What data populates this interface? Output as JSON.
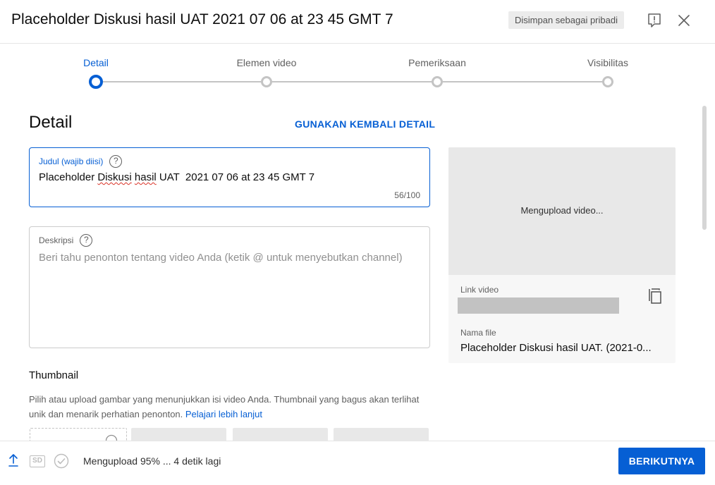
{
  "dialog": {
    "title": "Placeholder Diskusi hasil UAT 2021 07 06 at 23 45 GMT 7",
    "saved_status": "Disimpan sebagai pribadi",
    "report_icon": "report-icon",
    "close_icon": "close-icon"
  },
  "stepper": {
    "steps": [
      {
        "label": "Detail",
        "active": true
      },
      {
        "label": "Elemen video",
        "active": false
      },
      {
        "label": "Pemeriksaan",
        "active": false
      },
      {
        "label": "Visibilitas",
        "active": false
      }
    ]
  },
  "details": {
    "heading": "Detail",
    "reuse_label": "GUNAKAN KEMBALI DETAIL",
    "title_field": {
      "label": "Judul (wajib diisi)",
      "value_prefix": "Placeholder ",
      "value_misspelled_1": "Diskusi",
      "value_space": " ",
      "value_misspelled_2": "hasil",
      "value_suffix": " UAT  2021 07 06 at 23 45 GMT 7",
      "char_count": "56/100"
    },
    "description_field": {
      "label": "Deskripsi",
      "placeholder": "Beri tahu penonton tentang video Anda (ketik @ untuk menyebutkan channel)"
    },
    "help_glyph": "?"
  },
  "thumbnail": {
    "heading": "Thumbnail",
    "description": "Pilih atau upload gambar yang menunjukkan isi video Anda. Thumbnail yang bagus akan terlihat unik dan menarik perhatian penonton.",
    "learn_more": "Pelajari lebih lanjut"
  },
  "side_panel": {
    "preview_status": "Mengupload video...",
    "link_label": "Link video",
    "file_label": "Nama file",
    "file_value": "Placeholder Diskusi hasil UAT. (2021-0..."
  },
  "footer": {
    "sd_badge": "SD",
    "status": "Mengupload 95% ... 4 detik lagi",
    "next_label": "BERIKUTNYA"
  },
  "colors": {
    "accent": "#065fd4",
    "spell_error": "#d93025"
  }
}
